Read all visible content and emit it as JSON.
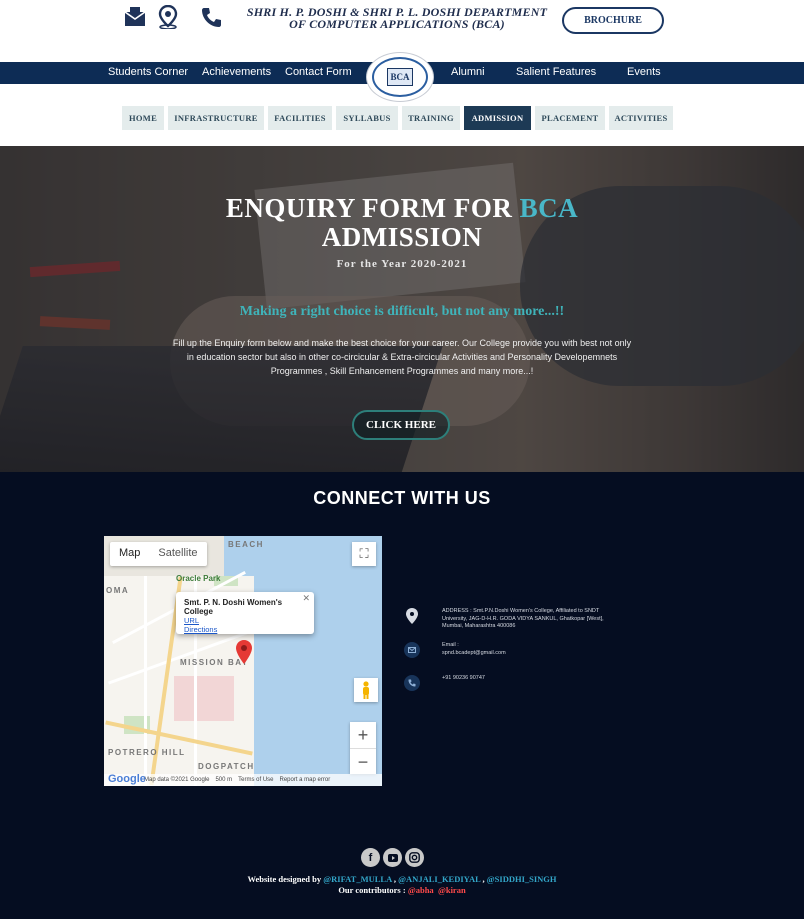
{
  "header": {
    "department_line1": "SHRI H. P. DOSHI & SHRI P. L. DOSHI DEPARTMENT",
    "department_line2": "OF COMPUTER APPLICATIONS (BCA)",
    "brochure_label": "BROCHURE",
    "icons": [
      "mail-icon",
      "location-icon",
      "phone-icon"
    ]
  },
  "navbar": {
    "items": [
      "Students Corner",
      "Achievements",
      "Contact Form",
      "Alumni",
      "Salient Features",
      "Events"
    ],
    "logo_text": "BCA"
  },
  "menu": {
    "items": [
      "HOME",
      "INFRASTRUCTURE",
      "FACILITIES",
      "SYLLABUS",
      "TRAINING",
      "ADMISSION",
      "PLACEMENT",
      "ACTIVITIES"
    ],
    "active": "ADMISSION"
  },
  "hero": {
    "title_part1": "ENQUIRY FORM FOR ",
    "title_highlight": "BCA",
    "title_part2": "ADMISSION",
    "year": "For the Year 2020-2021",
    "tagline": "Making a right choice is difficult, but not any more...!!",
    "description": "Fill up the Enquiry form below and make the best choice for your career. Our College provide you with best not only in education sector but also in other co-circicular & Extra-circicular Activities and Personality Developemnets Programmes , Skill Enhancement Programmes and many more...!",
    "button_label": "CLICK HERE"
  },
  "connect": {
    "title": "CONNECT WITH US",
    "map": {
      "map_tab": "Map",
      "satellite_tab": "Satellite",
      "place_name": "Smt. P. N. Doshi Women's College",
      "link1": "URL",
      "link2": "Directions",
      "area_label": "MISSION BAY",
      "area_label2": "POTRERO HILL",
      "area_label3": "DOGPATCH",
      "area_label4": "BEACH",
      "area_label5": "OMA",
      "poi": "Oracle Park",
      "footer_data": "Map data ©2021 Google",
      "footer_scale": "500 m",
      "footer_terms": "Terms of Use",
      "footer_report": "Report a map error",
      "brand": "Google"
    },
    "address": "ADDRESS : Smt.P.N.Doshi Women's College, Affiliated to SNDT University, JAG-D-H.R. GODA VIDYA SANKUL, Ghatkopar [West], Mumbai, Maharashtra 400086",
    "email_label": "Email :",
    "email": "spnd.bcadept@gmail.com",
    "phone": "+91 90236 90747"
  },
  "footer": {
    "designed_by": "Website designed by ",
    "designers": [
      "@RIFAT_MULLA",
      "@ANJALI_KEDIYAL",
      "@SIDDHI_SINGH"
    ],
    "contributors_label": "Our contributors : ",
    "contributors": [
      "@abha",
      "@kiran"
    ],
    "social_icons": [
      "facebook-icon",
      "youtube-icon",
      "instagram-icon"
    ]
  },
  "colors": {
    "navy": "#0d2c55",
    "dark_bg": "#050d21",
    "teal": "#49b7c8",
    "active_menu": "#1d3a55"
  }
}
